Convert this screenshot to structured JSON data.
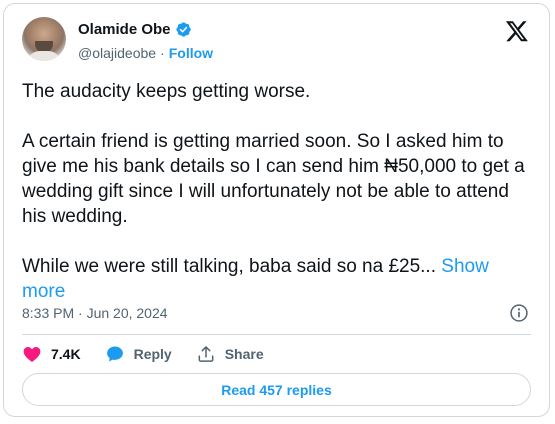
{
  "author": {
    "name": "Olamide Obe",
    "handle": "@olajideobe",
    "separator": "·",
    "follow_label": "Follow"
  },
  "tweet": {
    "paragraphs": [
      "The audacity keeps getting worse.",
      "A certain friend is getting married soon. So I asked him to give me his bank details so I can send him ₦50,000 to get a wedding gift since I will unfortunately not be able to attend his wedding.",
      "While we were still talking, baba said so na £25..."
    ],
    "show_more_label": "Show more",
    "timestamp": "8:33 PM · Jun 20, 2024"
  },
  "actions": {
    "likes": "7.4K",
    "reply_label": "Reply",
    "share_label": "Share"
  },
  "read_replies_label": "Read 457 replies",
  "icons": {
    "verified": "verified-badge-icon",
    "logo": "x-logo-icon",
    "info": "info-icon",
    "like": "heart-icon",
    "reply": "speech-bubble-icon",
    "share": "share-upload-icon"
  },
  "colors": {
    "accent": "#1d9bf0",
    "like": "#f91880",
    "muted": "#536471",
    "border": "#cfd9de"
  }
}
